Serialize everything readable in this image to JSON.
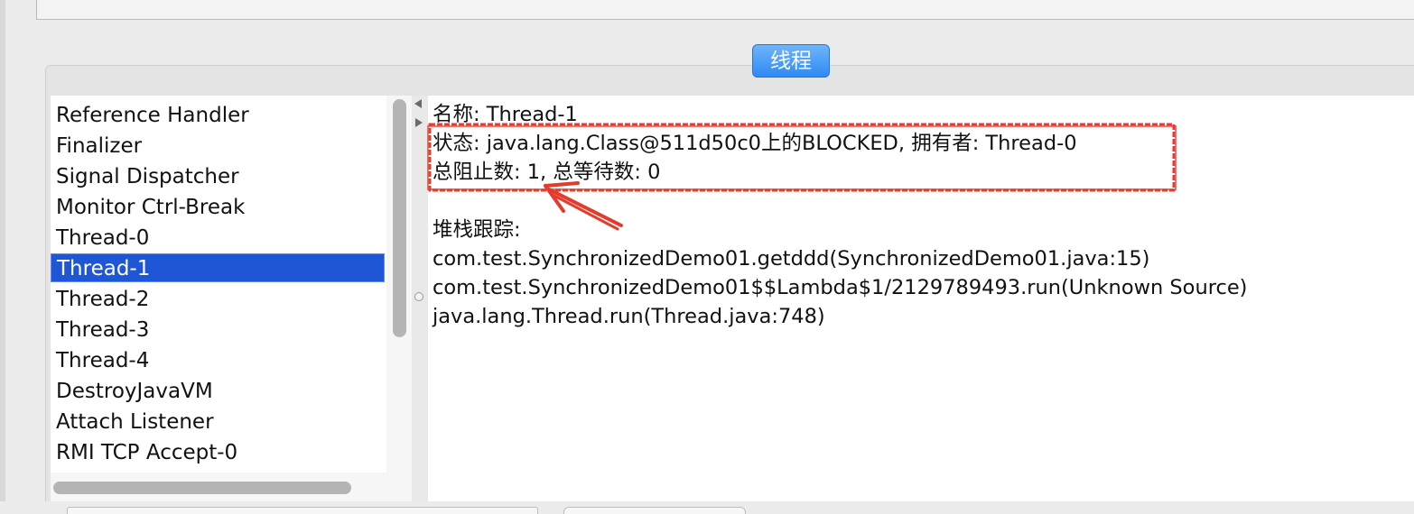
{
  "tab": {
    "label": "线程"
  },
  "thread_list": {
    "items": [
      "Reference Handler",
      "Finalizer",
      "Signal Dispatcher",
      "Monitor Ctrl-Break",
      "Thread-0",
      "Thread-1",
      "Thread-2",
      "Thread-3",
      "Thread-4",
      "DestroyJavaVM",
      "Attach Listener",
      "RMI TCP Accept-0"
    ],
    "selected": "Thread-1"
  },
  "details": {
    "name_line": "名称: Thread-1",
    "state_line": "状态: java.lang.Class@511d50c0上的BLOCKED, 拥有者: Thread-0",
    "counts_line": "总阻止数: 1, 总等待数: 0",
    "stack_label": "堆栈跟踪:",
    "stack": [
      "com.test.SynchronizedDemo01.getddd(SynchronizedDemo01.java:15)",
      "com.test.SynchronizedDemo01$$Lambda$1/2129789493.run(Unknown Source)",
      "java.lang.Thread.run(Thread.java:748)"
    ]
  },
  "colors": {
    "selection": "#1f56d6",
    "tab_blue": "#2e8af3",
    "annotation_red": "#e53a2c"
  }
}
